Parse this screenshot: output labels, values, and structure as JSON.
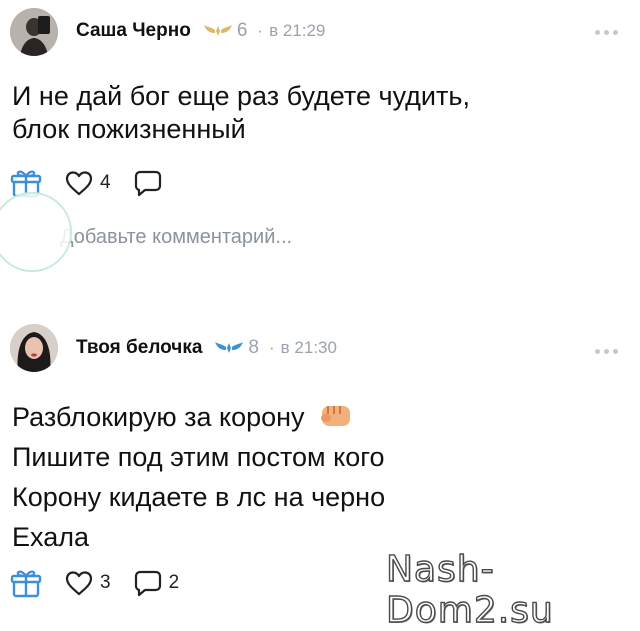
{
  "posts": [
    {
      "author": "Саша Черно",
      "level": "6",
      "time": "в 21:29",
      "lines": [
        "И не дай бог еще раз будете чудить,",
        "блок пожизненный"
      ],
      "likes": "4",
      "comments": ""
    },
    {
      "author": "Твоя белочка",
      "level": "8",
      "time": "в 21:30",
      "lines": [
        "Разблокирую за корону",
        "Пишите под этим постом кого",
        "Корону кидаете в лс на черно",
        "Ехала"
      ],
      "likes": "3",
      "comments": "2"
    }
  ],
  "comment_input": {
    "placeholder": "Добавьте комментарий..."
  },
  "watermark": "Nash-Dom2.su",
  "colors": {
    "muted": "#9aa3ad",
    "accent": "#3d8fd6",
    "level_badge": "#d9b96a"
  }
}
